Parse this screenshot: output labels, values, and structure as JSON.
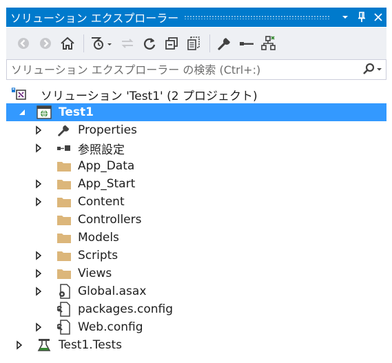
{
  "window": {
    "title": "ソリューション エクスプローラー",
    "pin_glyph": "▾",
    "dock_glyph": "⊥",
    "close_glyph": "✕"
  },
  "toolbar": {
    "buttons": [
      {
        "name": "back-button",
        "icon": "back-icon"
      },
      {
        "name": "forward-button",
        "icon": "forward-icon"
      },
      {
        "name": "home-button",
        "icon": "home-icon"
      },
      {
        "name": "pending-changes-filter-button",
        "icon": "clock-filter-icon"
      },
      {
        "name": "sync-with-active-document-button",
        "icon": "sync-icon"
      },
      {
        "name": "refresh-button",
        "icon": "refresh-icon"
      },
      {
        "name": "collapse-all-button",
        "icon": "collapse-all-icon"
      },
      {
        "name": "show-all-files-button",
        "icon": "show-all-files-icon"
      },
      {
        "name": "properties-button",
        "icon": "wrench-icon"
      },
      {
        "name": "preview-selected-items-button",
        "icon": "minus-icon"
      },
      {
        "name": "view-class-diagram-button",
        "icon": "class-diagram-icon"
      }
    ]
  },
  "search": {
    "placeholder": "ソリューション エクスプローラー の検索 (Ctrl+:)"
  },
  "tree": {
    "solution_label": "ソリューション 'Test1' (2 プロジェクト)",
    "project_label": "Test1",
    "items": [
      {
        "label": "Properties",
        "icon": "wrench-icon",
        "expandable": true
      },
      {
        "label": "参照設定",
        "icon": "references-icon",
        "expandable": true
      },
      {
        "label": "App_Data",
        "icon": "folder-icon",
        "expandable": false
      },
      {
        "label": "App_Start",
        "icon": "folder-icon",
        "expandable": true
      },
      {
        "label": "Content",
        "icon": "folder-icon",
        "expandable": true
      },
      {
        "label": "Controllers",
        "icon": "folder-icon",
        "expandable": false
      },
      {
        "label": "Models",
        "icon": "folder-icon",
        "expandable": false
      },
      {
        "label": "Scripts",
        "icon": "folder-icon",
        "expandable": true
      },
      {
        "label": "Views",
        "icon": "folder-icon",
        "expandable": true
      },
      {
        "label": "Global.asax",
        "icon": "asax-file-icon",
        "expandable": true
      },
      {
        "label": "packages.config",
        "icon": "config-file-icon",
        "expandable": false
      },
      {
        "label": "Web.config",
        "icon": "config-file-icon",
        "expandable": true
      }
    ],
    "test_project_label": "Test1.Tests"
  },
  "colors": {
    "accent": "#007acc",
    "selection": "#3399ff",
    "folder": "#dcb67a",
    "toolbar_bg": "#eef0f4"
  }
}
